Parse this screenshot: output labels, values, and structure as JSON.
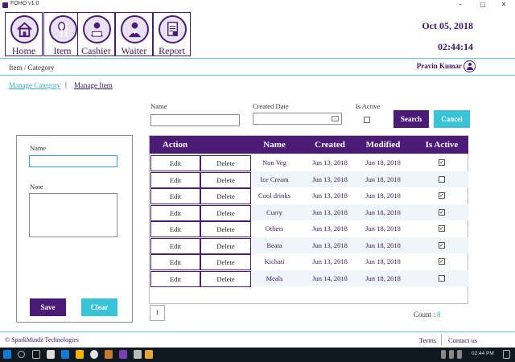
{
  "window": {
    "title": "FOHO v1.0",
    "controls": [
      "–",
      "▢",
      "✕"
    ]
  },
  "nav": [
    {
      "label": "Home",
      "icon": "home-icon"
    },
    {
      "label": "Item",
      "icon": "fork-spoon-icon"
    },
    {
      "label": "Cashier",
      "icon": "cashier-icon"
    },
    {
      "label": "Waiter",
      "icon": "waiter-icon"
    },
    {
      "label": "Report",
      "icon": "report-icon"
    }
  ],
  "header": {
    "date": "Oct 05, 2018",
    "time": "02:44:14"
  },
  "breadcrumb": "Item / Category",
  "user": {
    "name": "Pravin Kumar"
  },
  "subtabs": {
    "category": "Manage Category",
    "separator": "|",
    "item": "Manage Item"
  },
  "filters": {
    "name_label": "Name",
    "created_label": "Created Date",
    "active_label": "Is Active",
    "name_value": "",
    "created_value": "",
    "search": "Search",
    "cancel": "Cancel"
  },
  "form": {
    "name_label": "Name",
    "note_label": "Note",
    "name_value": "",
    "note_value": "",
    "save": "Save",
    "clear": "Clear"
  },
  "table": {
    "headers": {
      "action": "Action",
      "name": "Name",
      "created": "Created",
      "modified": "Modified",
      "active": "Is Active"
    },
    "edit_label": "Edit",
    "delete_label": "Delete",
    "rows": [
      {
        "name": "Non Veg",
        "created": "Jun 13, 2018",
        "modified": "Jun 18, 2018",
        "active": true
      },
      {
        "name": "Ice Cream",
        "created": "Jun 13, 2018",
        "modified": "Jun 18, 2018",
        "active": false
      },
      {
        "name": "Cool drinks",
        "created": "Jun 13, 2018",
        "modified": "Jun 18, 2018",
        "active": true
      },
      {
        "name": "Curry",
        "created": "Jun 13, 2018",
        "modified": "Jun 18, 2018",
        "active": true
      },
      {
        "name": "Others",
        "created": "Jun 13, 2018",
        "modified": "Jun 18, 2018",
        "active": true
      },
      {
        "name": "Beata",
        "created": "Jun 13, 2018",
        "modified": "Jun 18, 2018",
        "active": true
      },
      {
        "name": "Kichati",
        "created": "Jun 13, 2018",
        "modified": "Jun 18, 2018",
        "active": true
      },
      {
        "name": "Meals",
        "created": "Jun 14, 2018",
        "modified": "Jun 18, 2018",
        "active": false
      }
    ]
  },
  "pagination": {
    "page": "1"
  },
  "count": {
    "label": "Count :",
    "value": "8"
  },
  "footer": {
    "copyright": "© SparkMindz Technologies",
    "terms": "Terms",
    "contact": "Contact us"
  },
  "taskbar": {
    "time": "02:44 PM"
  },
  "colors": {
    "primary": "#4b1b78",
    "accent": "#38c3d7",
    "rule": "#63c7d6"
  }
}
